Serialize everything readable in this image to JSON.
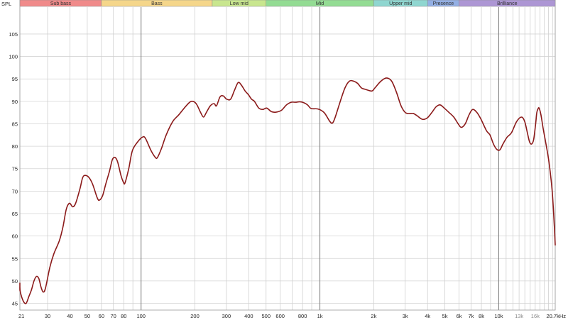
{
  "chart_data": {
    "type": "line",
    "x_scale": "log",
    "xlim": [
      21,
      20700
    ],
    "ylim": [
      43.5,
      111
    ],
    "ylabel": "SPL",
    "grid": true,
    "bands": [
      {
        "label": "Sub bass",
        "from": 21,
        "to": 60,
        "color": "#f08a8a"
      },
      {
        "label": "Bass",
        "from": 60,
        "to": 250,
        "color": "#f5d68a"
      },
      {
        "label": "Low mid",
        "from": 250,
        "to": 500,
        "color": "#c8e68e"
      },
      {
        "label": "Mid",
        "from": 500,
        "to": 2000,
        "color": "#93dc93"
      },
      {
        "label": "Upper mid",
        "from": 2000,
        "to": 4000,
        "color": "#8fd6d0"
      },
      {
        "label": "Presence",
        "from": 4000,
        "to": 6000,
        "color": "#93afe4"
      },
      {
        "label": "Brilliance",
        "from": 6000,
        "to": 20700,
        "color": "#ad96d4"
      }
    ],
    "y_ticks": [
      45,
      50,
      55,
      60,
      65,
      70,
      75,
      80,
      85,
      90,
      95,
      100,
      105
    ],
    "x_ticks": [
      {
        "value": 21,
        "label": "21"
      },
      {
        "value": 30,
        "label": "30"
      },
      {
        "value": 40,
        "label": "40"
      },
      {
        "value": 50,
        "label": "50"
      },
      {
        "value": 60,
        "label": "60"
      },
      {
        "value": 70,
        "label": "70"
      },
      {
        "value": 80,
        "label": "80"
      },
      {
        "value": 100,
        "label": "100"
      },
      {
        "value": 200,
        "label": "200"
      },
      {
        "value": 300,
        "label": "300"
      },
      {
        "value": 400,
        "label": "400"
      },
      {
        "value": 500,
        "label": "500"
      },
      {
        "value": 600,
        "label": "600"
      },
      {
        "value": 800,
        "label": "800"
      },
      {
        "value": 1000,
        "label": "1k"
      },
      {
        "value": 2000,
        "label": "2k"
      },
      {
        "value": 3000,
        "label": "3k"
      },
      {
        "value": 4000,
        "label": "4k"
      },
      {
        "value": 5000,
        "label": "5k"
      },
      {
        "value": 6000,
        "label": "6k"
      },
      {
        "value": 7000,
        "label": "7k"
      },
      {
        "value": 8000,
        "label": "8k"
      },
      {
        "value": 10000,
        "label": "10k"
      },
      {
        "value": 13000,
        "label": "13k",
        "faint": true
      },
      {
        "value": 16000,
        "label": "16k",
        "faint": true
      },
      {
        "value": 20700,
        "label": "20.7kHz"
      }
    ],
    "x_minor": [
      90,
      700,
      900,
      9000,
      11000,
      12000,
      14000,
      15000,
      17000,
      18000,
      19000,
      20000
    ],
    "x_major": [
      100,
      1000,
      10000
    ],
    "series": [
      {
        "color": "#8b1a1a",
        "points": [
          [
            21,
            49.5
          ],
          [
            22,
            49.0
          ],
          [
            23,
            48.0
          ],
          [
            24,
            48.0
          ],
          [
            25,
            48.7
          ],
          [
            26,
            47.5
          ],
          [
            27,
            45.5
          ],
          [
            28,
            45.0
          ],
          [
            29,
            46.5
          ],
          [
            30,
            48.0
          ],
          [
            31,
            50.0
          ],
          [
            32,
            51.0
          ],
          [
            33,
            50.5
          ],
          [
            34,
            48.5
          ],
          [
            35,
            47.5
          ],
          [
            36,
            48.5
          ],
          [
            38,
            53.0
          ],
          [
            40,
            56.0
          ],
          [
            43,
            59.0
          ],
          [
            45,
            62.0
          ],
          [
            47,
            66.0
          ],
          [
            49,
            67.3
          ],
          [
            51,
            66.5
          ],
          [
            53,
            67.3
          ],
          [
            56,
            70.5
          ],
          [
            58,
            73.0
          ],
          [
            60,
            73.5
          ],
          [
            63,
            73.0
          ],
          [
            66,
            71.5
          ],
          [
            70,
            68.5
          ],
          [
            72,
            68.0
          ],
          [
            75,
            69.0
          ],
          [
            78,
            71.5
          ],
          [
            82,
            74.5
          ],
          [
            85,
            77.0
          ],
          [
            88,
            77.5
          ],
          [
            91,
            76.5
          ],
          [
            95,
            73.5
          ],
          [
            98,
            72.0
          ],
          [
            100,
            71.8
          ],
          [
            105,
            75.0
          ],
          [
            110,
            79.0
          ],
          [
            118,
            81.0
          ],
          [
            125,
            82.0
          ],
          [
            130,
            81.8
          ],
          [
            140,
            79.0
          ],
          [
            148,
            77.5
          ],
          [
            152,
            77.5
          ],
          [
            160,
            79.5
          ],
          [
            170,
            82.5
          ],
          [
            185,
            85.5
          ],
          [
            200,
            87.0
          ],
          [
            220,
            89.0
          ],
          [
            235,
            90.0
          ],
          [
            250,
            89.5
          ],
          [
            265,
            87.5
          ],
          [
            275,
            86.5
          ],
          [
            285,
            87.5
          ],
          [
            300,
            89.0
          ],
          [
            315,
            89.5
          ],
          [
            325,
            89.0
          ],
          [
            340,
            91.0
          ],
          [
            355,
            91.2
          ],
          [
            370,
            90.5
          ],
          [
            390,
            90.5
          ],
          [
            410,
            92.5
          ],
          [
            430,
            94.2
          ],
          [
            450,
            93.5
          ],
          [
            470,
            92.3
          ],
          [
            490,
            91.5
          ],
          [
            510,
            90.5
          ],
          [
            530,
            90.0
          ],
          [
            560,
            88.5
          ],
          [
            590,
            88.2
          ],
          [
            620,
            88.5
          ],
          [
            660,
            87.7
          ],
          [
            700,
            87.6
          ],
          [
            750,
            88.0
          ],
          [
            800,
            89.2
          ],
          [
            850,
            89.8
          ],
          [
            900,
            89.8
          ],
          [
            950,
            89.9
          ],
          [
            1000,
            89.7
          ],
          [
            1050,
            89.2
          ],
          [
            1100,
            88.4
          ],
          [
            1200,
            88.3
          ],
          [
            1300,
            87.5
          ],
          [
            1400,
            85.5
          ],
          [
            1450,
            85.2
          ],
          [
            1500,
            86.5
          ],
          [
            1600,
            90.0
          ],
          [
            1700,
            93.0
          ],
          [
            1800,
            94.5
          ],
          [
            1900,
            94.5
          ],
          [
            2000,
            94.0
          ],
          [
            2100,
            93.0
          ],
          [
            2200,
            92.7
          ],
          [
            2400,
            92.3
          ],
          [
            2500,
            93.0
          ],
          [
            2700,
            94.5
          ],
          [
            2900,
            95.2
          ],
          [
            3100,
            94.5
          ],
          [
            3300,
            92.0
          ],
          [
            3500,
            89.0
          ],
          [
            3700,
            87.5
          ],
          [
            3900,
            87.3
          ],
          [
            4100,
            87.3
          ],
          [
            4300,
            86.8
          ],
          [
            4600,
            86.0
          ],
          [
            4900,
            86.3
          ],
          [
            5200,
            87.5
          ],
          [
            5500,
            88.8
          ],
          [
            5800,
            89.2
          ],
          [
            6100,
            88.5
          ],
          [
            6500,
            87.5
          ],
          [
            6900,
            86.5
          ],
          [
            7300,
            85.0
          ],
          [
            7600,
            84.2
          ],
          [
            8000,
            85.0
          ],
          [
            8400,
            87.0
          ],
          [
            8800,
            88.2
          ],
          [
            9300,
            87.5
          ],
          [
            9800,
            86.0
          ],
          [
            10500,
            83.5
          ],
          [
            11000,
            82.5
          ],
          [
            11500,
            80.5
          ],
          [
            12000,
            79.3
          ],
          [
            12500,
            79.2
          ],
          [
            13000,
            80.5
          ],
          [
            13700,
            82.0
          ],
          [
            14500,
            83.0
          ],
          [
            15500,
            85.5
          ],
          [
            16500,
            86.5
          ],
          [
            17200,
            85.5
          ],
          [
            17800,
            83.0
          ],
          [
            18300,
            81.0
          ],
          [
            18800,
            80.5
          ],
          [
            19300,
            81.5
          ],
          [
            19800,
            85.0
          ],
          [
            20100,
            87.5
          ],
          [
            20400,
            88.3
          ],
          [
            20700,
            88.5
          ],
          [
            21200,
            87.0
          ],
          [
            21800,
            84.0
          ],
          [
            22500,
            81.0
          ],
          [
            23500,
            76.5
          ],
          [
            24500,
            70.0
          ],
          [
            25200,
            62.0
          ],
          [
            25500,
            58.0
          ]
        ]
      }
    ]
  }
}
